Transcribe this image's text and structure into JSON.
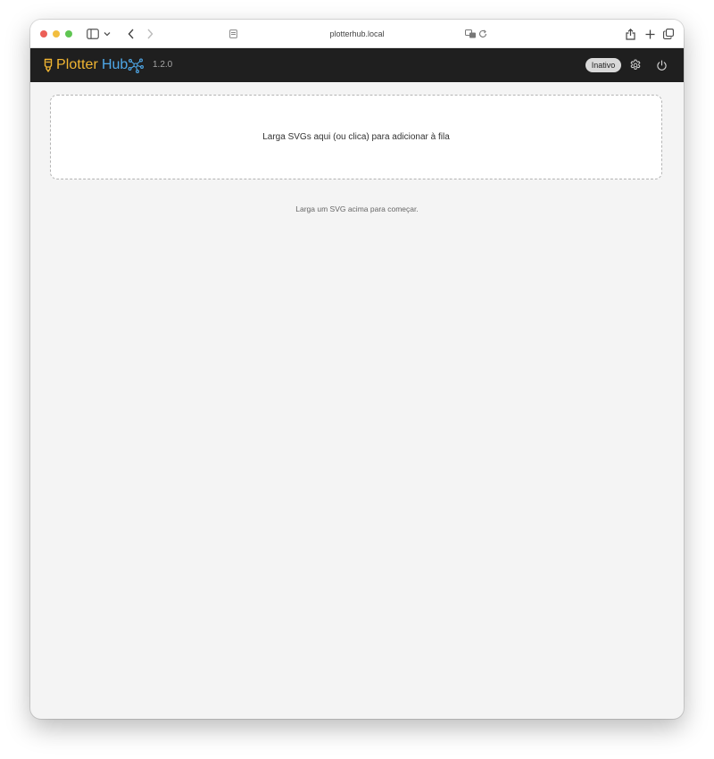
{
  "browser": {
    "url": "plotterhub.local"
  },
  "app": {
    "brand_primary": "Plotter",
    "brand_secondary": "Hub",
    "version": "1.2.0",
    "status": "Inativo",
    "colors": {
      "brand_yellow": "#f2b632",
      "brand_blue": "#4fa9ea",
      "header_bg": "#1f1f1f"
    },
    "icons": [
      "pen-icon",
      "graph-icon",
      "gear-icon",
      "power-icon"
    ]
  },
  "main": {
    "dropzone_text": "Larga SVGs aqui (ou clica) para adicionar à fila",
    "empty_hint": "Larga um SVG acima para começar."
  }
}
